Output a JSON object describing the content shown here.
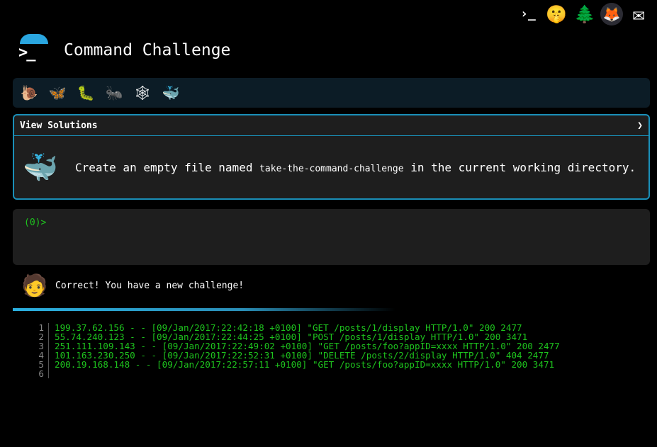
{
  "top_icons": [
    {
      "name": "cmdchallenge-logo-icon",
      "glyph": "›_"
    },
    {
      "name": "shushing-face-icon",
      "glyph": "🤫"
    },
    {
      "name": "tree-icon",
      "glyph": "🌲"
    },
    {
      "name": "gitlab-icon",
      "glyph": "🦊"
    },
    {
      "name": "mail-icon",
      "glyph": "✉"
    }
  ],
  "header": {
    "title": "Command Challenge"
  },
  "levels": [
    {
      "name": "snail-icon",
      "glyph": "🐌"
    },
    {
      "name": "butterfly-icon",
      "glyph": "🦋"
    },
    {
      "name": "caterpillar-icon",
      "glyph": "🐛"
    },
    {
      "name": "ant-icon",
      "glyph": "🐜"
    },
    {
      "name": "spider-web-icon",
      "glyph": "🕸"
    },
    {
      "name": "whale-icon",
      "glyph": "🐳"
    }
  ],
  "challenge": {
    "view_solutions_label": "View Solutions",
    "chevron": "❯",
    "text_before": "Create an empty file named ",
    "filename": "take-the-command-challenge",
    "text_after": " in the current working directory."
  },
  "terminal": {
    "prompt": "(0)>"
  },
  "feedback": {
    "message": "Correct! You have a new challenge!"
  },
  "code_lines": [
    {
      "n": "1",
      "text": "199.37.62.156 - - [09/Jan/2017:22:42:18 +0100] \"GET /posts/1/display HTTP/1.0\" 200 2477"
    },
    {
      "n": "2",
      "text": "55.74.240.123 - - [09/Jan/2017:22:44:25 +0100] \"POST /posts/1/display HTTP/1.0\" 200 3471"
    },
    {
      "n": "3",
      "text": "251.111.109.143 - - [09/Jan/2017:22:49:02 +0100] \"GET /posts/foo?appID=xxxx HTTP/1.0\" 200 2477"
    },
    {
      "n": "4",
      "text": "101.163.230.250 - - [09/Jan/2017:22:52:31 +0100] \"DELETE /posts/2/display HTTP/1.0\" 404 2477"
    },
    {
      "n": "5",
      "text": "200.19.168.148 - - [09/Jan/2017:22:57:11 +0100] \"GET /posts/foo?appID=xxxx HTTP/1.0\" 200 3471"
    },
    {
      "n": "6",
      "text": ""
    }
  ]
}
